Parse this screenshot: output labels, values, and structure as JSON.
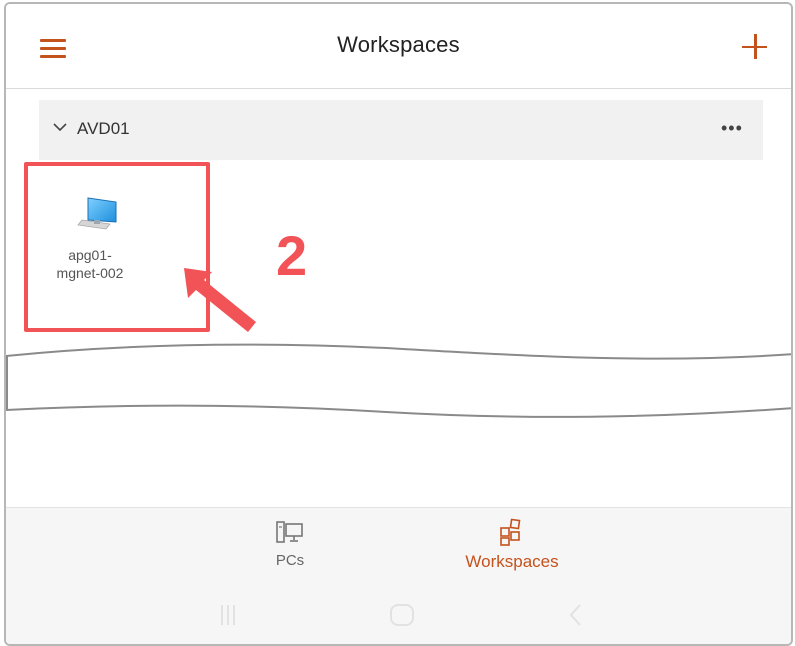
{
  "header": {
    "title": "Workspaces",
    "menu_icon": "hamburger-menu-icon",
    "add_icon": "plus-icon"
  },
  "group": {
    "name": "AVD01",
    "expand_icon": "chevron-down-icon",
    "more_icon": "more-horizontal-icon",
    "more_label": "•••"
  },
  "pc": {
    "label_line1": "apg01-",
    "label_line2": "mgnet-002",
    "icon": "monitor-icon"
  },
  "annotation": {
    "step": "2",
    "color": "#f25356"
  },
  "bottom_nav": {
    "items": [
      {
        "label": "PCs",
        "icon": "pc-icon",
        "active": false
      },
      {
        "label": "Workspaces",
        "icon": "workspaces-grid-icon",
        "active": true
      }
    ]
  },
  "system_nav": {
    "recent_icon": "recent-apps-icon",
    "home_icon": "home-icon",
    "back_icon": "back-icon"
  },
  "colors": {
    "accent": "#c4521d",
    "highlight": "#f25356",
    "group_bg": "#f1f1f1",
    "nav_bg": "#f6f6f6"
  }
}
